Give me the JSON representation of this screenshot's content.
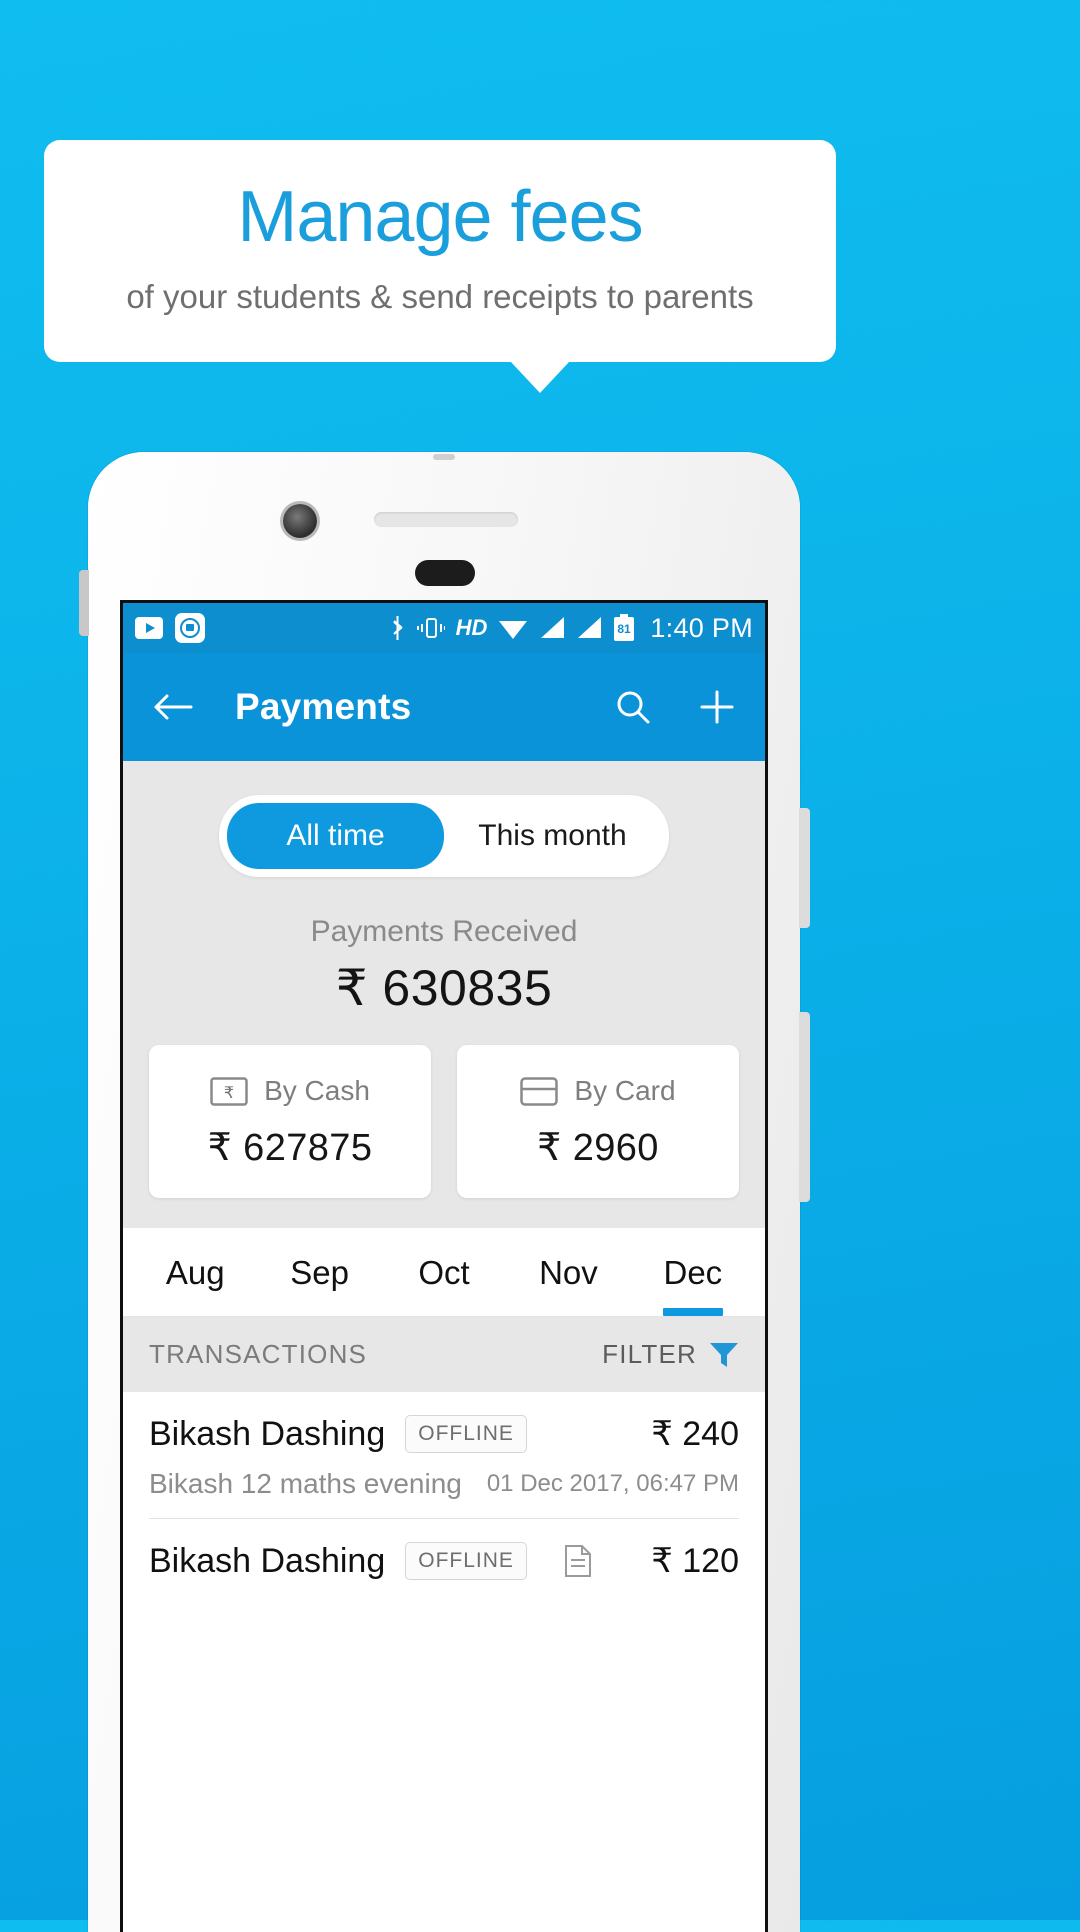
{
  "promo": {
    "title": "Manage fees",
    "subtitle": "of your students & send receipts to parents"
  },
  "colors": {
    "background_top": "#10bdf0",
    "background_bottom": "#069ee0",
    "accent": "#0f9ae0",
    "appbar": "#0a93d8",
    "statusbar": "#0d8ecf"
  },
  "statusbar": {
    "time": "1:40 PM",
    "battery_level": "81",
    "network_label": "HD",
    "left_icons": [
      "youtube-icon",
      "camera-app-icon"
    ],
    "right_icons": [
      "bluetooth-icon",
      "vibrate-icon",
      "hd-icon",
      "wifi-icon",
      "signal-icon-1",
      "signal-icon-2",
      "battery-icon"
    ]
  },
  "appbar": {
    "title": "Payments",
    "back_icon": "back-arrow-icon",
    "search_icon": "search-icon",
    "add_icon": "plus-icon"
  },
  "segments": [
    {
      "label": "All time",
      "active": true
    },
    {
      "label": "This month",
      "active": false
    }
  ],
  "summary": {
    "received_label": "Payments Received",
    "received_amount": "₹ 630835",
    "methods": [
      {
        "icon": "cash-note-icon",
        "label": "By Cash",
        "amount": "₹ 627875"
      },
      {
        "icon": "credit-card-icon",
        "label": "By Card",
        "amount": "₹ 2960"
      }
    ]
  },
  "months": [
    {
      "label": "Aug",
      "active": false
    },
    {
      "label": "Sep",
      "active": false
    },
    {
      "label": "Oct",
      "active": false
    },
    {
      "label": "Nov",
      "active": false
    },
    {
      "label": "Dec",
      "active": true
    }
  ],
  "transactions_header": {
    "title": "TRANSACTIONS",
    "filter_label": "FILTER",
    "filter_icon": "funnel-icon"
  },
  "transactions": [
    {
      "name": "Bikash Dashing",
      "badge": "OFFLINE",
      "amount": "₹ 240",
      "description": "Bikash 12 maths evening",
      "date": "01 Dec 2017, 06:47 PM",
      "has_receipt": false
    },
    {
      "name": "Bikash Dashing",
      "badge": "OFFLINE",
      "amount": "₹ 120",
      "description": "",
      "date": "",
      "has_receipt": true
    }
  ]
}
